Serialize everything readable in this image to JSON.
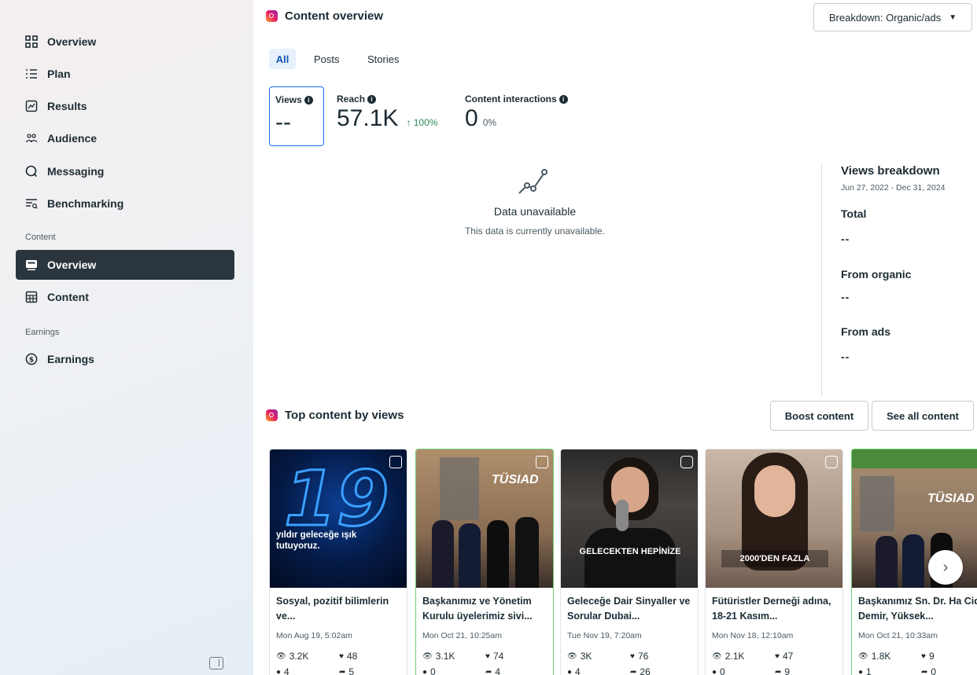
{
  "sidebar": {
    "items": [
      {
        "label": "Overview",
        "icon": "overview-icon"
      },
      {
        "label": "Plan",
        "icon": "plan-list-icon"
      },
      {
        "label": "Results",
        "icon": "results-chart-icon"
      },
      {
        "label": "Audience",
        "icon": "audience-icon"
      },
      {
        "label": "Messaging",
        "icon": "messaging-icon"
      },
      {
        "label": "Benchmarking",
        "icon": "benchmarking-icon"
      }
    ],
    "content_section": "Content",
    "content_items": [
      {
        "label": "Overview",
        "icon": "content-overview-icon",
        "active": true
      },
      {
        "label": "Content",
        "icon": "content-grid-icon"
      }
    ],
    "earnings_section": "Earnings",
    "earnings_items": [
      {
        "label": "Earnings",
        "icon": "earnings-dollar-icon"
      }
    ]
  },
  "overview": {
    "title": "Content overview",
    "breakdown_button": "Breakdown: Organic/ads",
    "tabs": [
      "All",
      "Posts",
      "Stories"
    ],
    "active_tab": "All",
    "metrics": {
      "views": {
        "label": "Views",
        "value": "--"
      },
      "reach": {
        "label": "Reach",
        "value": "57.1K",
        "change": "↑ 100%"
      },
      "interactions": {
        "label": "Content interactions",
        "value": "0",
        "change": "0%"
      }
    },
    "unavailable": {
      "title": "Data unavailable",
      "subtitle": "This data is currently unavailable."
    },
    "breakdown": {
      "title": "Views breakdown",
      "date_range": "Jun 27, 2022 - Dec 31, 2024",
      "total_label": "Total",
      "total_value": "--",
      "organic_label": "From organic",
      "organic_value": "--",
      "ads_label": "From ads",
      "ads_value": "--"
    }
  },
  "top_content": {
    "title": "Top content by views",
    "boost_button": "Boost content",
    "see_all_button": "See all content",
    "posts": [
      {
        "title": "Sosyal, pozitif bilimlerin ve...",
        "date": "Mon Aug 19, 5:02am",
        "views": "3.2K",
        "likes": "48",
        "comments": "4",
        "shares": "5",
        "overlay": "19",
        "overlay_caption": "yıldır geleceğe ışık tutuyoruz."
      },
      {
        "title": "Başkanımız ve Yönetim Kurulu üyelerimiz sivi...",
        "date": "Mon Oct 21, 10:25am",
        "views": "3.1K",
        "likes": "74",
        "comments": "0",
        "shares": "4",
        "overlay": "TÜSIAD"
      },
      {
        "title": "Geleceğe Dair Sinyaller ve Sorular Dubai...",
        "date": "Tue Nov 19, 7:20am",
        "views": "3K",
        "likes": "76",
        "comments": "4",
        "shares": "26",
        "overlay": "GELECEKTEN HEPİNİZE"
      },
      {
        "title": "Fütüristler Derneği adına, 18-21 Kasım...",
        "date": "Mon Nov 18, 12:10am",
        "views": "2.1K",
        "likes": "47",
        "comments": "0",
        "shares": "9",
        "overlay": "2000'DEN FAZLA"
      },
      {
        "title": "Başkanımız Sn. Dr. Ha Cide Demir, Yüksek...",
        "date": "Mon Oct 21, 10:33am",
        "views": "1.8K",
        "likes": "9",
        "comments": "1",
        "shares": "0",
        "overlay": "TÜSIAD"
      }
    ]
  },
  "colors": {
    "active_nav": "#2b353d",
    "tab_active_bg": "#e7f1fd",
    "tab_active_text": "#1458b8",
    "positive": "#2e8b57",
    "card_border_green": "#6fcf72"
  }
}
